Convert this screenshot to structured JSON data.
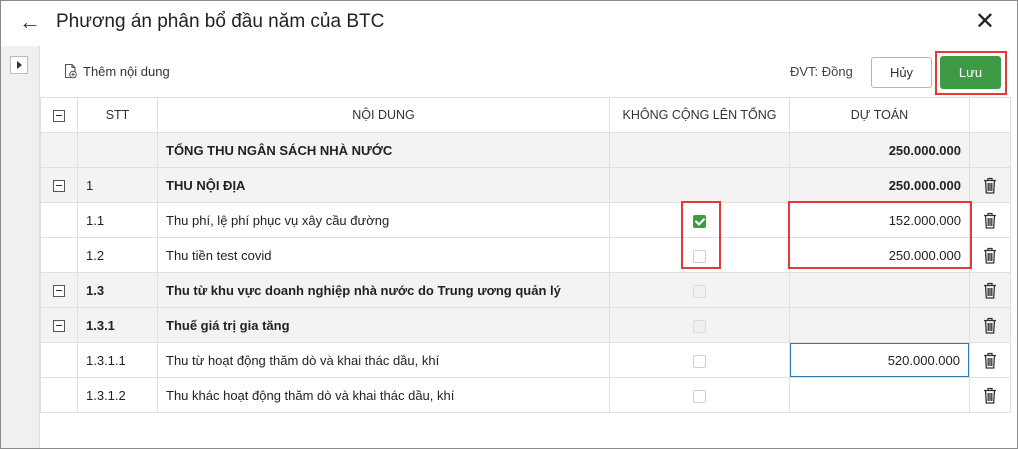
{
  "window": {
    "title": "Phương án phân bổ đầu năm của BTC",
    "back_icon": "←",
    "close_icon": "✕"
  },
  "toolbar": {
    "add_label": "Thêm nội dung",
    "unit_label": "ĐVT: Đồng",
    "cancel_label": "Hủy",
    "save_label": "Lưu"
  },
  "table": {
    "headers": {
      "stt": "STT",
      "content": "NỘI DUNG",
      "no_sum": "KHÔNG CỘNG LÊN TỔNG",
      "estimate": "DỰ TOÁN"
    },
    "rows": [
      {
        "stt": "",
        "content": "TỔNG THU NGÂN SÁCH NHÀ NƯỚC",
        "estimate": "250.000.000"
      },
      {
        "stt": "1",
        "content": "THU NỘI ĐỊA",
        "estimate": "250.000.000"
      },
      {
        "stt": "1.1",
        "content": "Thu phí, lệ phí phục vụ xây cầu đường",
        "no_sum_checked": true,
        "estimate": "152.000.000"
      },
      {
        "stt": "1.2",
        "content": "Thu tiền test covid",
        "no_sum_checked": false,
        "estimate": "250.000.000"
      },
      {
        "stt": "1.3",
        "content": "Thu từ khu vực doanh nghiệp nhà nước do Trung ương quản lý",
        "estimate": ""
      },
      {
        "stt": "1.3.1",
        "content": "Thuế giá trị gia tăng",
        "estimate": ""
      },
      {
        "stt": "1.3.1.1",
        "content": "Thu từ hoạt động thăm dò và khai thác dầu, khí",
        "no_sum_checked": false,
        "estimate": "520.000.000"
      },
      {
        "stt": "1.3.1.2",
        "content": "Thu khác hoạt động thăm dò và khai thác dầu, khí",
        "no_sum_checked": false,
        "estimate": ""
      }
    ]
  },
  "colors": {
    "accent_green": "#3f9a45",
    "highlight_red": "#e53935",
    "input_focus": "#2b7bb9"
  }
}
